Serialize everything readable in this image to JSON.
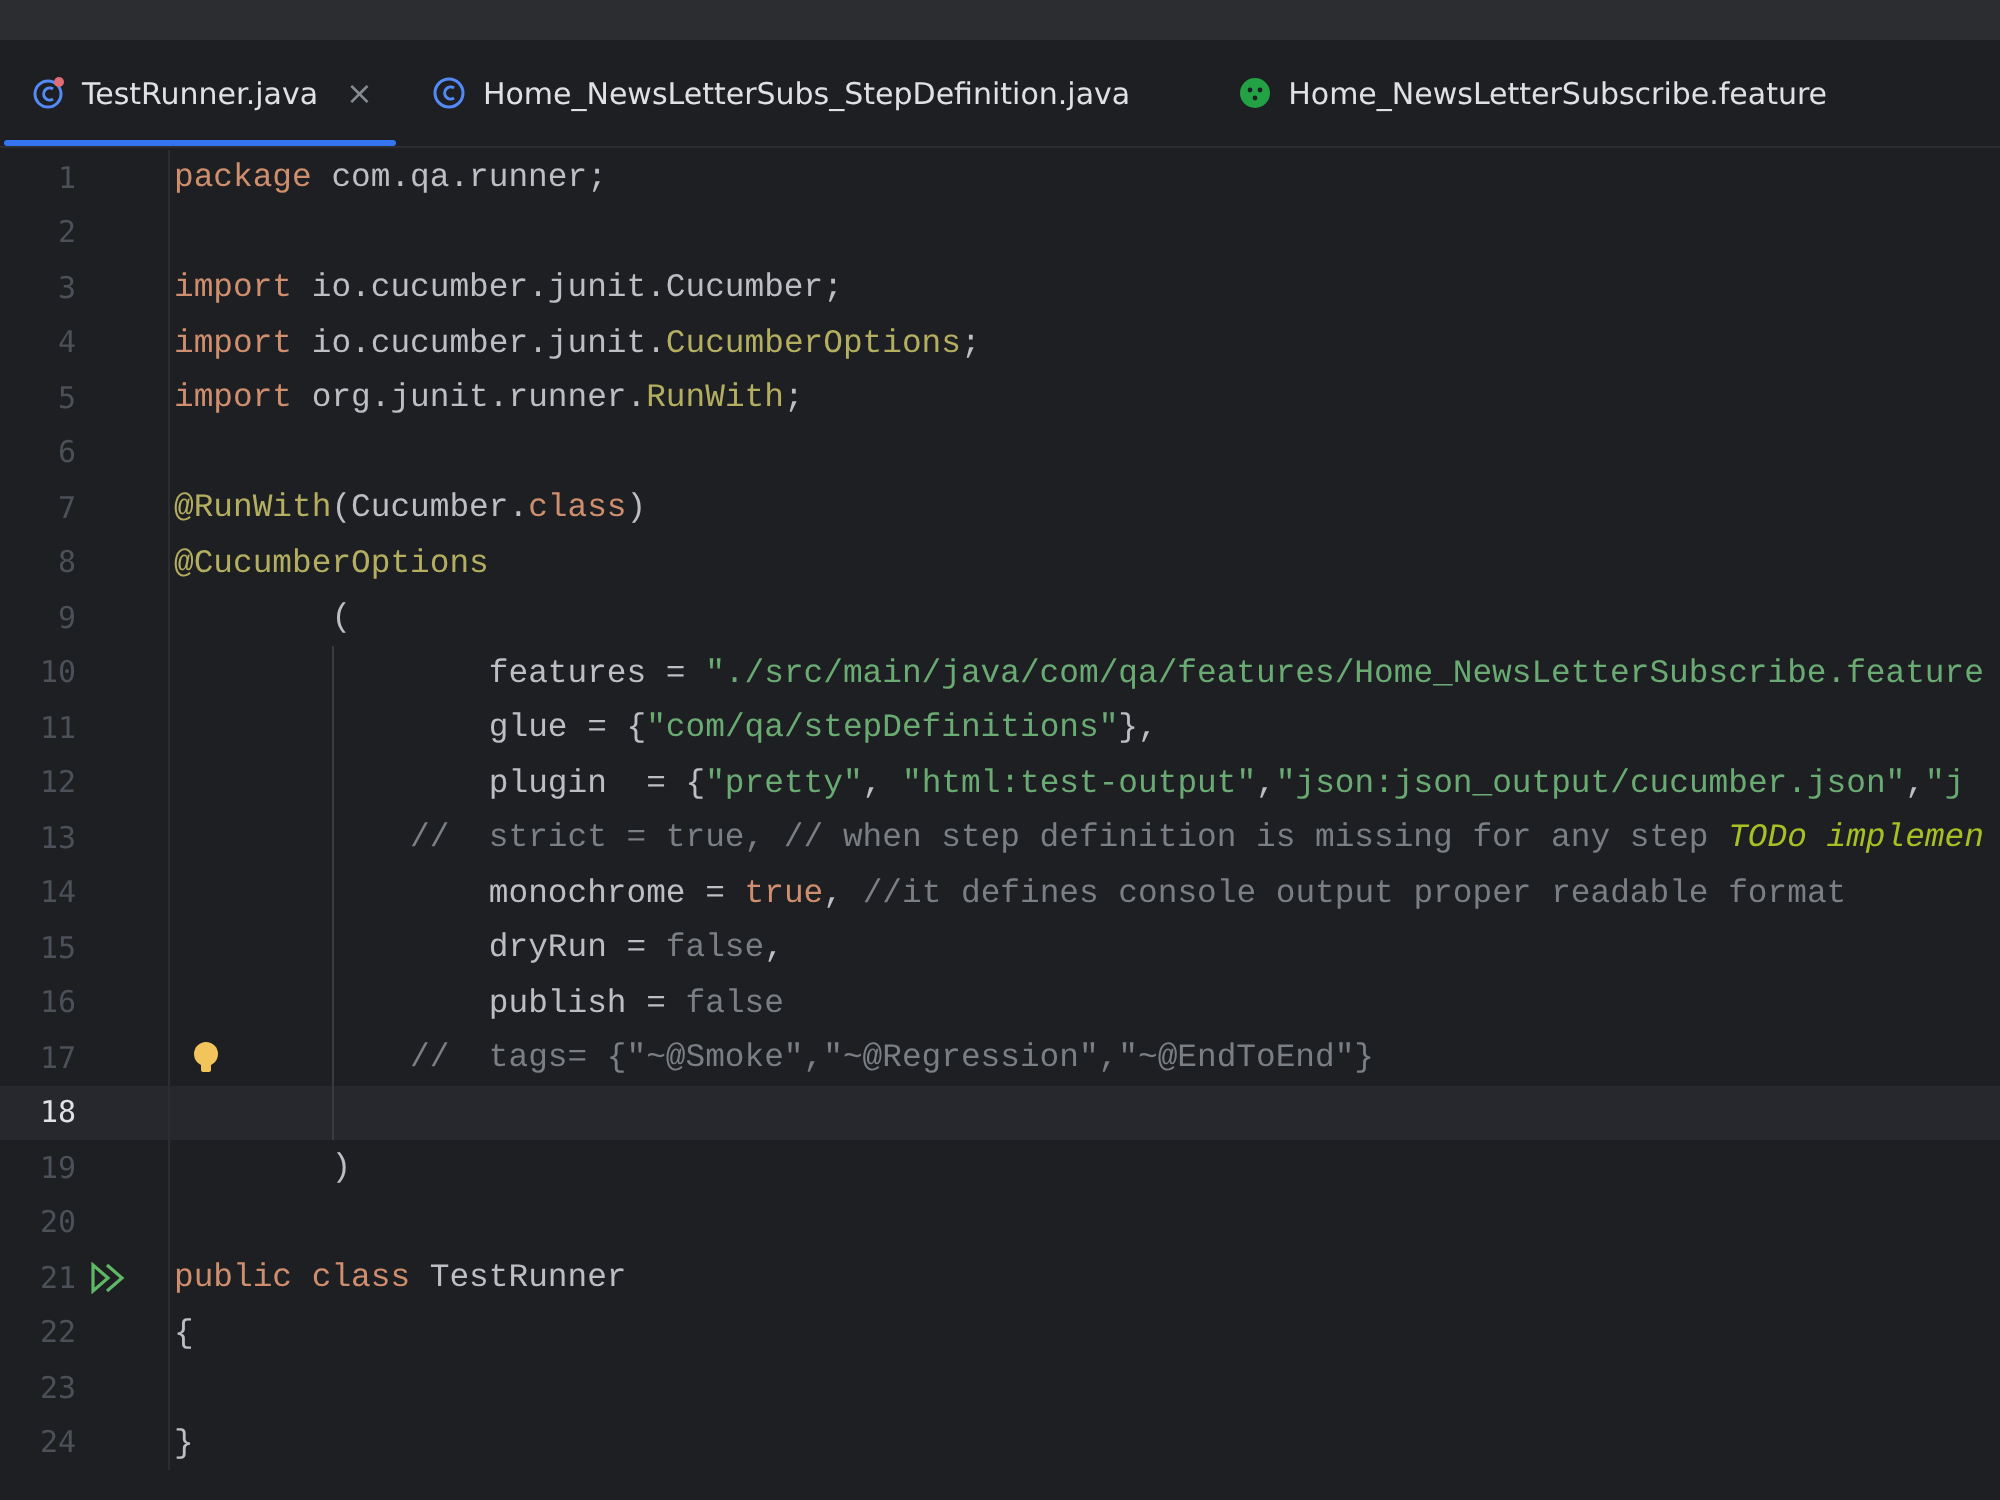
{
  "tabs": [
    {
      "label": "TestRunner.java",
      "kind": "runner",
      "selected": true,
      "close": "×"
    },
    {
      "label": "Home_NewsLetterSubs_StepDefinition.java",
      "kind": "class",
      "selected": false
    },
    {
      "label": "Home_NewsLetterSubscribe.feature",
      "kind": "feature",
      "selected": false
    }
  ],
  "lines": [
    {
      "number": "1",
      "tokens": [
        {
          "kind": "keyword",
          "text": "package"
        },
        {
          "kind": "plain",
          "text": " com.qa.runner;"
        }
      ]
    },
    {
      "number": "2"
    },
    {
      "number": "3",
      "tokens": [
        {
          "kind": "keyword",
          "text": "import"
        },
        {
          "kind": "plain",
          "text": " io.cucumber.junit.Cucumber;"
        }
      ]
    },
    {
      "number": "4",
      "tokens": [
        {
          "kind": "keyword",
          "text": "import"
        },
        {
          "kind": "plain",
          "text": " io.cucumber.junit."
        },
        {
          "kind": "annotation",
          "text": "CucumberOptions"
        },
        {
          "kind": "plain",
          "text": ";"
        }
      ]
    },
    {
      "number": "5",
      "tokens": [
        {
          "kind": "keyword",
          "text": "import"
        },
        {
          "kind": "plain",
          "text": " org.junit.runner."
        },
        {
          "kind": "annotation",
          "text": "RunWith"
        },
        {
          "kind": "plain",
          "text": ";"
        }
      ]
    },
    {
      "number": "6"
    },
    {
      "number": "7",
      "tokens": [
        {
          "kind": "annotation",
          "text": "@RunWith"
        },
        {
          "kind": "plain",
          "text": "(Cucumber."
        },
        {
          "kind": "keyword",
          "text": "class"
        },
        {
          "kind": "plain",
          "text": ")"
        }
      ]
    },
    {
      "number": "8",
      "tokens": [
        {
          "kind": "annotation",
          "text": "@CucumberOptions"
        }
      ]
    },
    {
      "number": "9",
      "tokens": [
        {
          "kind": "plain",
          "text": "        ("
        }
      ]
    },
    {
      "number": "10",
      "tokens": [
        {
          "kind": "plain",
          "text": "                features = "
        },
        {
          "kind": "string",
          "text": "\"./src/main/java/com/qa/features/Home_NewsLetterSubscribe.feature"
        }
      ]
    },
    {
      "number": "11",
      "tokens": [
        {
          "kind": "plain",
          "text": "                glue = {"
        },
        {
          "kind": "string",
          "text": "\"com/qa/stepDefinitions\""
        },
        {
          "kind": "plain",
          "text": "},"
        }
      ]
    },
    {
      "number": "12",
      "tokens": [
        {
          "kind": "plain",
          "text": "                plugin  = {"
        },
        {
          "kind": "string",
          "text": "\"pretty\""
        },
        {
          "kind": "plain",
          "text": ", "
        },
        {
          "kind": "string",
          "text": "\"html:test-output\""
        },
        {
          "kind": "plain",
          "text": ","
        },
        {
          "kind": "string",
          "text": "\"json:json_output/cucumber.json\""
        },
        {
          "kind": "plain",
          "text": ","
        },
        {
          "kind": "string",
          "text": "\"j"
        }
      ]
    },
    {
      "number": "13",
      "tokens": [
        {
          "kind": "comment",
          "text": "            //  strict = true, // when step definition is missing for any step "
        },
        {
          "kind": "todo",
          "text": "TODo implemen"
        }
      ]
    },
    {
      "number": "14",
      "tokens": [
        {
          "kind": "plain",
          "text": "                monochrome = "
        },
        {
          "kind": "keyword",
          "text": "true"
        },
        {
          "kind": "plain",
          "text": ", "
        },
        {
          "kind": "comment",
          "text": "//it defines console output proper readable format"
        }
      ]
    },
    {
      "number": "15",
      "tokens": [
        {
          "kind": "plain",
          "text": "                dryRun = "
        },
        {
          "kind": "dim",
          "text": "false"
        },
        {
          "kind": "plain",
          "text": ","
        }
      ]
    },
    {
      "number": "16",
      "tokens": [
        {
          "kind": "plain",
          "text": "                publish = "
        },
        {
          "kind": "dim",
          "text": "false"
        }
      ]
    },
    {
      "number": "17",
      "kind": "hint",
      "tokens": [
        {
          "kind": "comment",
          "text": "            //  tags= {\"~@Smoke\",\"~@Regression\",\"~@EndToEnd\"}"
        }
      ]
    },
    {
      "number": "18",
      "current": true
    },
    {
      "number": "19",
      "tokens": [
        {
          "kind": "plain",
          "text": "        )"
        }
      ]
    },
    {
      "number": "20"
    },
    {
      "number": "21",
      "kind": "run",
      "tokens": [
        {
          "kind": "keyword",
          "text": "public class"
        },
        {
          "kind": "plain",
          "text": " TestRunner"
        }
      ]
    },
    {
      "number": "22",
      "tokens": [
        {
          "kind": "plain",
          "text": "{"
        }
      ]
    },
    {
      "number": "23"
    },
    {
      "number": "24",
      "tokens": [
        {
          "kind": "plain",
          "text": "}"
        }
      ]
    }
  ]
}
